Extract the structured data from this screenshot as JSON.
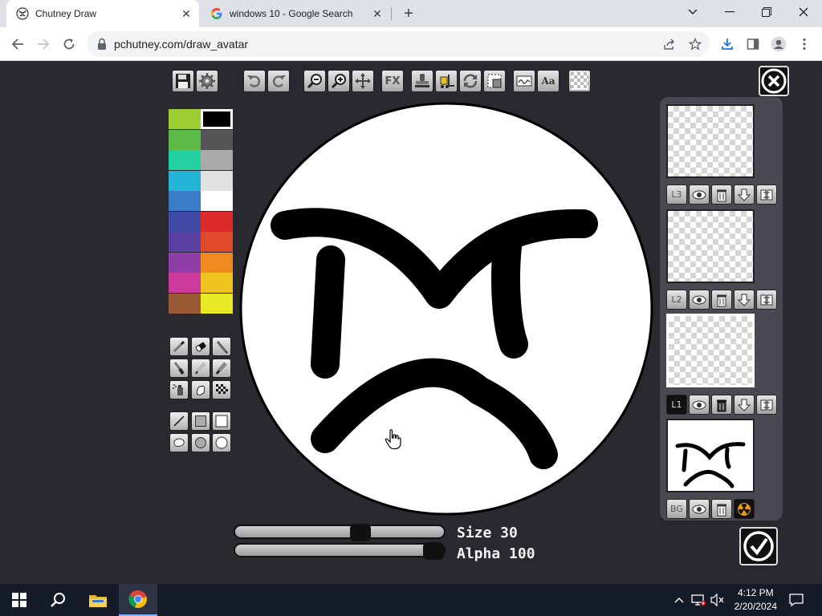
{
  "browser": {
    "tabs": [
      {
        "title": "Chutney Draw",
        "active": true
      },
      {
        "title": "windows 10 - Google Search",
        "active": false
      }
    ],
    "url": "pchutney.com/draw_avatar"
  },
  "toolbar": {
    "fx_label": "FX",
    "text_label": "Aa"
  },
  "palette": {
    "left_column": [
      "#9ccd33",
      "#5cbb46",
      "#22d0a0",
      "#24b4d6",
      "#3a7cc6",
      "#3e49a3",
      "#5b3fa0",
      "#8f3ea8",
      "#cc3a9b",
      "#9a5a35"
    ],
    "right_column": [
      "#000000",
      "#555555",
      "#aaaaaa",
      "#e2e2e2",
      "#ffffff",
      "#dd2a2a",
      "#e04a2a",
      "#ef8a22",
      "#efc21f",
      "#e8e824"
    ],
    "selected": "#000000"
  },
  "sliders": {
    "size_label": "Size 30",
    "size_value": 30,
    "size_max": 50,
    "alpha_label": "Alpha 100",
    "alpha_value": 100,
    "alpha_max": 100
  },
  "layers": {
    "items": [
      {
        "label": "L3",
        "active": false
      },
      {
        "label": "L2",
        "active": false
      },
      {
        "label": "L1",
        "active": true
      },
      {
        "label": "BG",
        "active": false
      }
    ]
  },
  "taskbar": {
    "time": "4:12 PM",
    "date": "2/20/2024"
  }
}
